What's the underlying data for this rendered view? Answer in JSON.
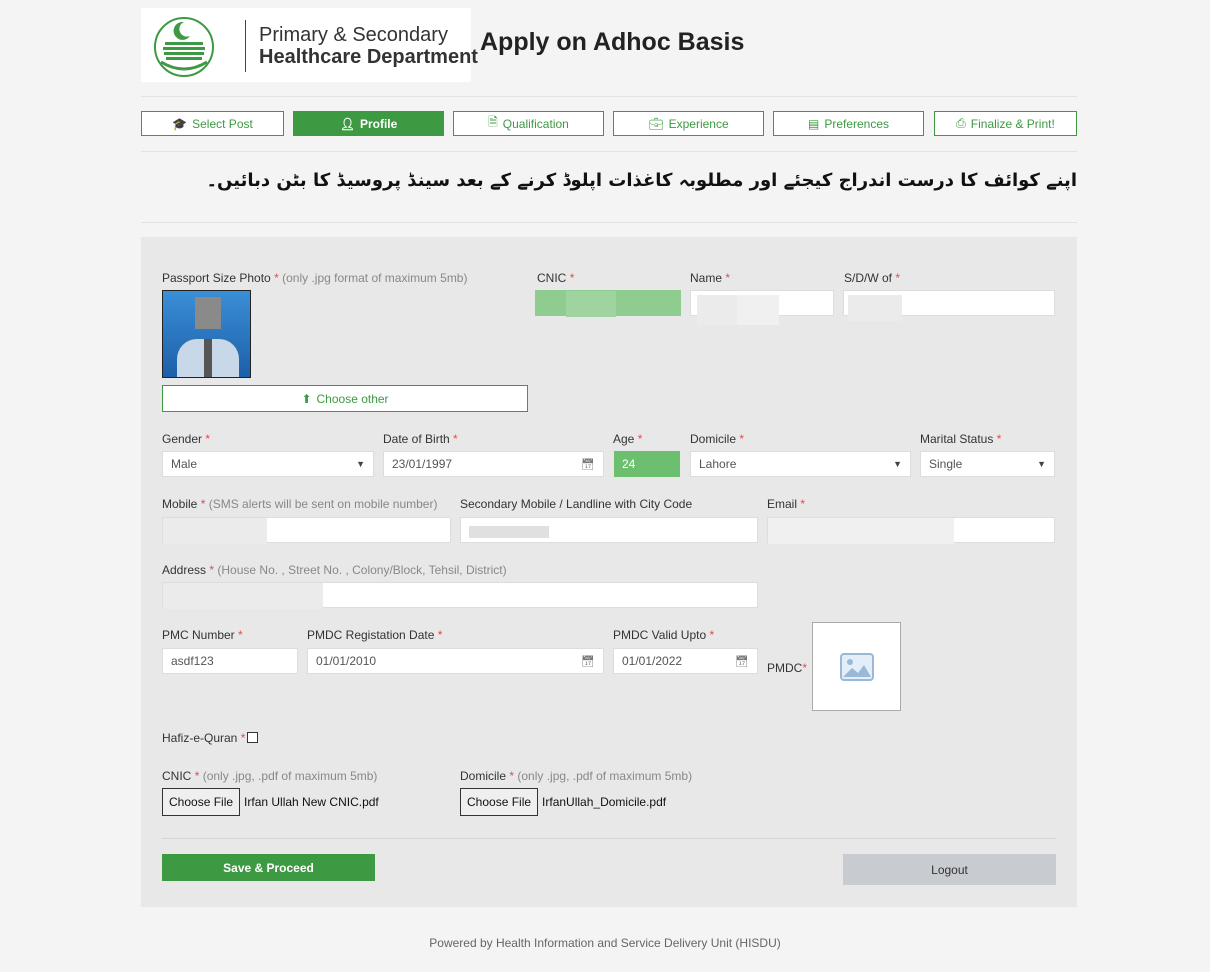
{
  "header": {
    "logo_line1": "Primary & Secondary",
    "logo_line2": "Healthcare Department",
    "title": "Apply on Adhoc Basis"
  },
  "steps": [
    {
      "label": "Select Post",
      "icon": "graduation-cap-icon",
      "active": false
    },
    {
      "label": "Profile",
      "icon": "user-icon",
      "active": true
    },
    {
      "label": "Qualification",
      "icon": "file-icon",
      "active": false
    },
    {
      "label": "Experience",
      "icon": "briefcase-icon",
      "active": false
    },
    {
      "label": "Preferences",
      "icon": "building-icon",
      "active": false
    },
    {
      "label": "Finalize & Print!",
      "icon": "print-icon",
      "active": false
    }
  ],
  "instruction_urdu": "اپنے کوائف کا درست اندراج کیجئے اور مطلوبہ کاغذات اپلوڈ کرنے کے بعد سینڈ پروسیڈ کا بٹن دبائیں۔",
  "form": {
    "photo": {
      "label": "Passport Size Photo",
      "note": "(only .jpg format of maximum 5mb)",
      "choose_label": "Choose other"
    },
    "cnic": {
      "label": "CNIC"
    },
    "name": {
      "label": "Name"
    },
    "sdw": {
      "label": "S/D/W of"
    },
    "gender": {
      "label": "Gender",
      "value": "Male"
    },
    "dob": {
      "label": "Date of Birth",
      "value": "23/01/1997"
    },
    "age": {
      "label": "Age",
      "value": "24"
    },
    "domicile": {
      "label": "Domicile",
      "value": "Lahore"
    },
    "marital": {
      "label": "Marital Status",
      "value": "Single"
    },
    "mobile": {
      "label": "Mobile",
      "note": "(SMS alerts will be sent on mobile number)"
    },
    "secondary_mobile": {
      "label": "Secondary Mobile / Landline with City Code"
    },
    "email": {
      "label": "Email"
    },
    "address": {
      "label": "Address",
      "note": "(House No. , Street No. , Colony/Block, Tehsil, District)"
    },
    "pmc_number": {
      "label": "PMC Number",
      "value": "asdf123"
    },
    "pmdc_reg_date": {
      "label": "PMDC Registation Date",
      "value": "01/01/2010"
    },
    "pmdc_valid": {
      "label": "PMDC Valid Upto",
      "value": "01/01/2022"
    },
    "pmdc_image": {
      "label": "PMDC"
    },
    "hafiz": {
      "label": "Hafiz-e-Quran",
      "checked": false
    },
    "cnic_file": {
      "label": "CNIC",
      "note": "(only .jpg, .pdf of maximum 5mb)",
      "button": "Choose File",
      "file": "Irfan Ullah New CNIC.pdf"
    },
    "domicile_file": {
      "label": "Domicile",
      "note": "(only .jpg, .pdf of maximum 5mb)",
      "button": "Choose File",
      "file": "IrfanUllah_Domicile.pdf"
    },
    "required_mark": "*"
  },
  "actions": {
    "save": "Save & Proceed",
    "logout": "Logout"
  },
  "footer": "Powered by Health Information and Service Delivery Unit (HISDU)",
  "colors": {
    "brand_green": "#3d9a42",
    "age_green": "#6bbf6f",
    "required_red": "#e14c4c",
    "panel": "#e8e8e8"
  }
}
